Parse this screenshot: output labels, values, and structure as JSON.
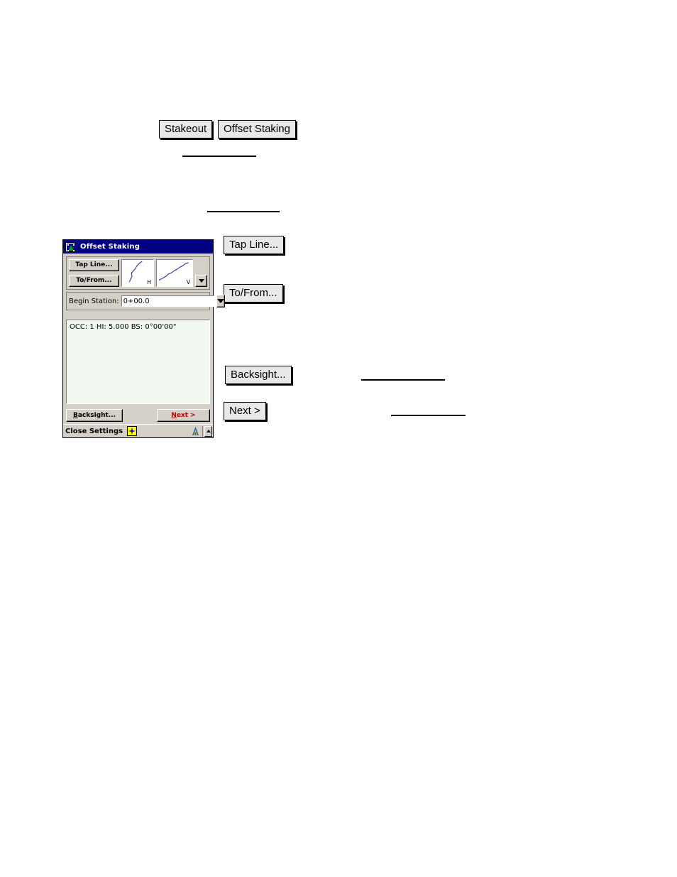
{
  "document": {
    "inline_buttons": [
      {
        "id": "stakeout",
        "label": "Stakeout"
      },
      {
        "id": "offset-staking",
        "label": "Offset Staking"
      }
    ],
    "callouts": [
      {
        "id": "tap-line",
        "label": "Tap Line..."
      },
      {
        "id": "to-from",
        "label": "To/From..."
      },
      {
        "id": "backsight",
        "label": "Backsight..."
      },
      {
        "id": "next",
        "label": "Next >"
      }
    ],
    "blank_rules_count": 5
  },
  "device": {
    "titlebar": {
      "icon": "application-window-icon",
      "title": "Offset Staking"
    },
    "tool_panel": {
      "buttons": [
        {
          "id": "tap-line",
          "label": "Tap Line..."
        },
        {
          "id": "to-from",
          "label": "To/From..."
        }
      ],
      "previews": [
        {
          "id": "horizontal",
          "label": "H",
          "icon": "horizontal-alignment-graph"
        },
        {
          "id": "vertical",
          "label": "V",
          "icon": "vertical-alignment-graph"
        }
      ],
      "dropdown_icon": "chevron-down-icon"
    },
    "station_row": {
      "label": "Begin Station:",
      "value": "0+00.0",
      "placeholder": "0+00.0",
      "dropdown_icon": "chevron-down-icon"
    },
    "status": {
      "text": "OCC: 1  HI: 5.000  BS: 0°00'00\""
    },
    "actions": {
      "backsight": {
        "label": "Backsight...",
        "accel": "B"
      },
      "next": {
        "label": "Next >",
        "accel": "N",
        "color": "#c00000"
      }
    },
    "taskbar": {
      "label": "Close Settings",
      "tray_star_icon": "star-tray-icon",
      "tray_app_icon": "surveyor-tray-icon",
      "tray_up_icon": "chevron-up-icon"
    },
    "colors": {
      "titlebar": "#000080",
      "face": "#d4d0c8",
      "field": "#ffffff",
      "list_background": "#f0f8f0",
      "accent_red": "#c00000",
      "graph_line": "#3333aa"
    }
  }
}
